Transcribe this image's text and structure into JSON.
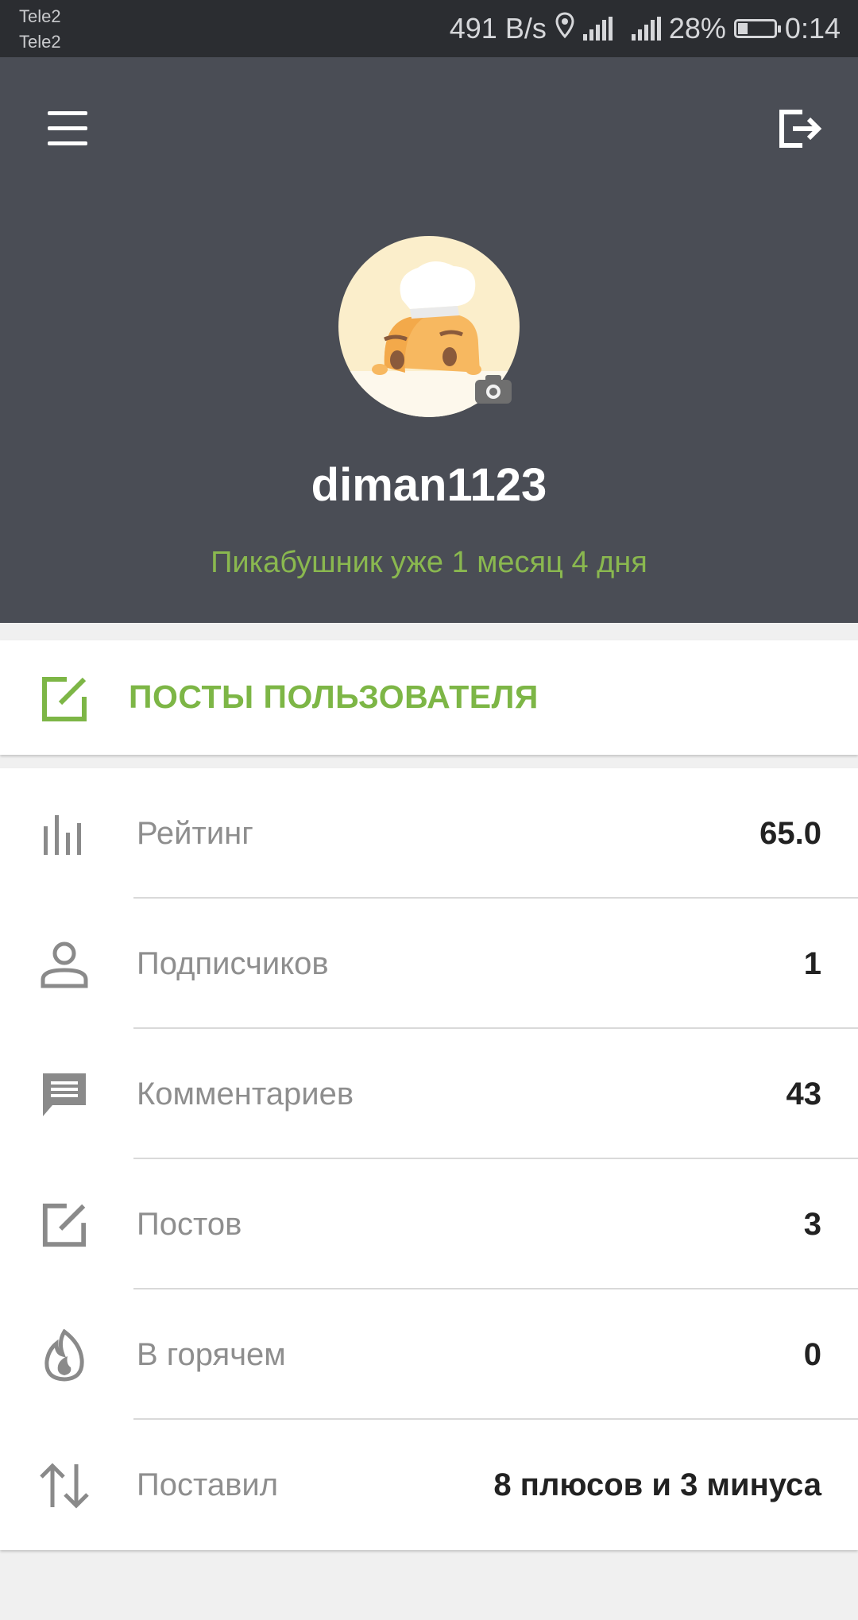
{
  "status_bar": {
    "carrier_1": "Tele2",
    "carrier_2": "Tele2",
    "net_speed": "491 B/s",
    "battery_percent": "28%",
    "time": "0:14",
    "battery_level": 0.28
  },
  "header": {
    "background_color": "#4a4d55",
    "menu_icon": "hamburger-menu-icon",
    "logout_icon": "logout-icon"
  },
  "profile": {
    "username": "diman1123",
    "tenure": "Пикабушник уже 1 месяц 4 дня",
    "avatar": "chef-toast-avatar",
    "camera_icon": "camera-icon"
  },
  "posts_button": {
    "label": "ПОСТЫ ПОЛЬЗОВАТЕЛЯ",
    "icon": "edit-icon",
    "color": "#7db646"
  },
  "stats": [
    {
      "icon": "bar-chart-icon",
      "label": "Рейтинг",
      "value": "65.0"
    },
    {
      "icon": "person-icon",
      "label": "Подписчиков",
      "value": "1"
    },
    {
      "icon": "comment-icon",
      "label": "Комментариев",
      "value": "43"
    },
    {
      "icon": "edit-icon",
      "label": "Постов",
      "value": "3"
    },
    {
      "icon": "fire-icon",
      "label": "В горячем",
      "value": "0"
    },
    {
      "icon": "up-down-arrows-icon",
      "label": "Поставил",
      "value": "8 плюсов и 3 минуса"
    }
  ]
}
